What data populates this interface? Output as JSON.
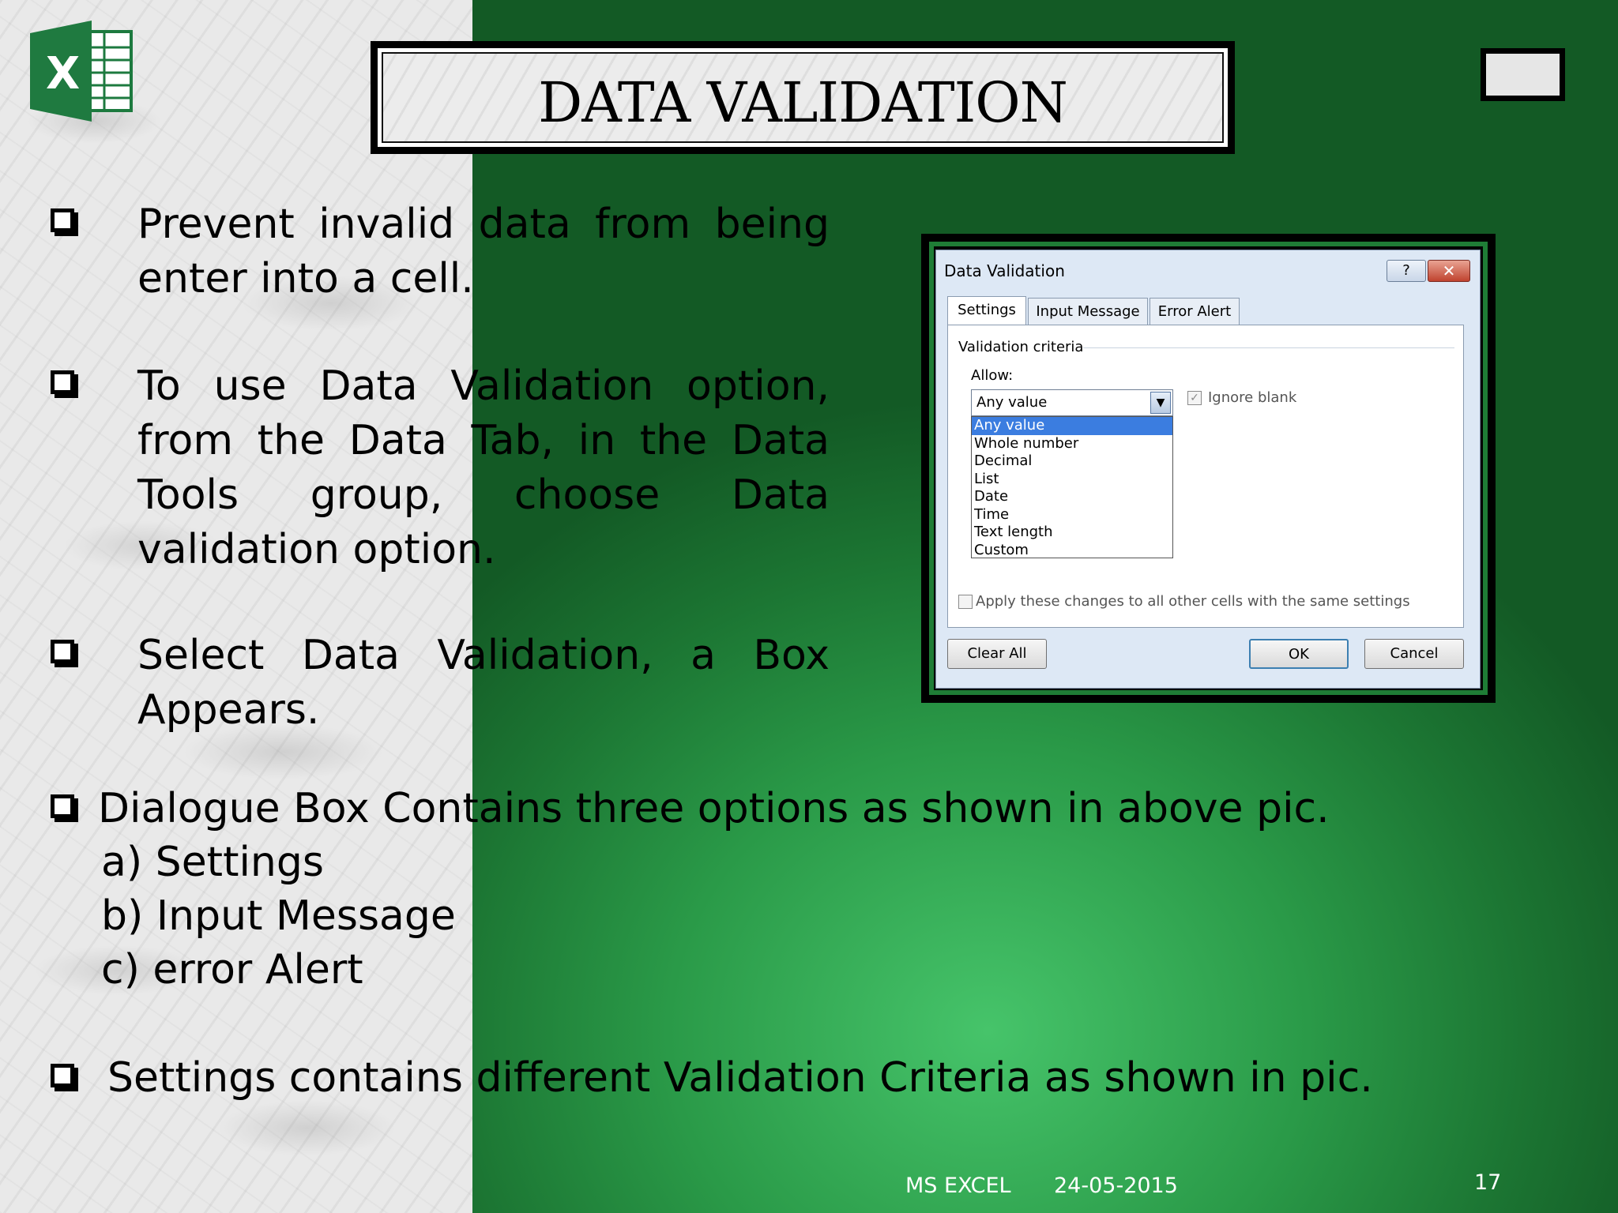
{
  "slide": {
    "title": "DATA VALIDATION",
    "bullets": [
      "Prevent invalid data from being enter into a cell.",
      "To use Data Validation option, from the Data Tab, in the Data Tools group, choose Data validation option.",
      "Select Data Validation, a Box Appears."
    ],
    "dialogue": {
      "intro": "Dialogue Box Contains three options as shown in above pic.",
      "items": [
        "a) Settings",
        "b) Input Message",
        "c) error Alert"
      ]
    },
    "settings_note": "Settings contains different Validation Criteria as shown in pic.",
    "footer": {
      "left": "MS EXCEL",
      "date": "24-05-2015",
      "page": "17"
    }
  },
  "dialog": {
    "title": "Data Validation",
    "help": "?",
    "close": "✕",
    "tabs": [
      "Settings",
      "Input Message",
      "Error Alert"
    ],
    "section": "Validation criteria",
    "allow_label": "Allow:",
    "allow_value": "Any value",
    "ignore_blank": "Ignore blank",
    "options": [
      "Any value",
      "Whole number",
      "Decimal",
      "List",
      "Date",
      "Time",
      "Text length",
      "Custom"
    ],
    "apply_label": "Apply these changes to all other cells with the same settings",
    "buttons": {
      "clear": "Clear All",
      "ok": "OK",
      "cancel": "Cancel"
    }
  },
  "colors": {
    "green_dark": "#135a25",
    "green_light": "#46c46a",
    "selection": "#3b7de0"
  },
  "icons": {
    "logo": "excel-logo-icon",
    "bullet": "checkbox-bullet-icon",
    "dropdown": "chevron-down-icon"
  }
}
